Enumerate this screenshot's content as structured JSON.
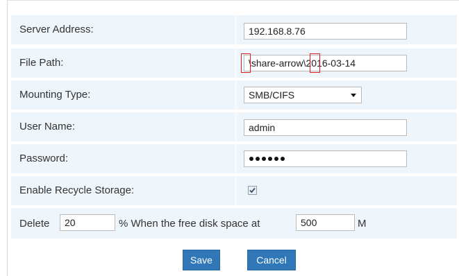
{
  "form": {
    "server_address": {
      "label": "Server Address:",
      "value": "192.168.8.76"
    },
    "file_path": {
      "label": "File Path:",
      "segment_1": "\\",
      "segment_2": "share-arrow",
      "segment_3": "\\",
      "segment_4": "2016-03-14"
    },
    "mounting_type": {
      "label": "Mounting Type:",
      "selected": "SMB/CIFS"
    },
    "user_name": {
      "label": "User Name:",
      "value": "admin"
    },
    "password": {
      "label": "Password:",
      "masked_length": 6
    },
    "recycle": {
      "label": "Enable Recycle Storage:",
      "checked": true
    },
    "delete_rule": {
      "prefix": "Delete",
      "percent_value": "20",
      "middle": "% When the free disk space at",
      "space_value": "500",
      "unit": "M"
    }
  },
  "buttons": {
    "save_label": "Save",
    "cancel_label": "Cancel"
  },
  "colors": {
    "row_background": "#eef5fb",
    "button_background": "#2f77b6",
    "highlight_marker": "#e02020"
  }
}
